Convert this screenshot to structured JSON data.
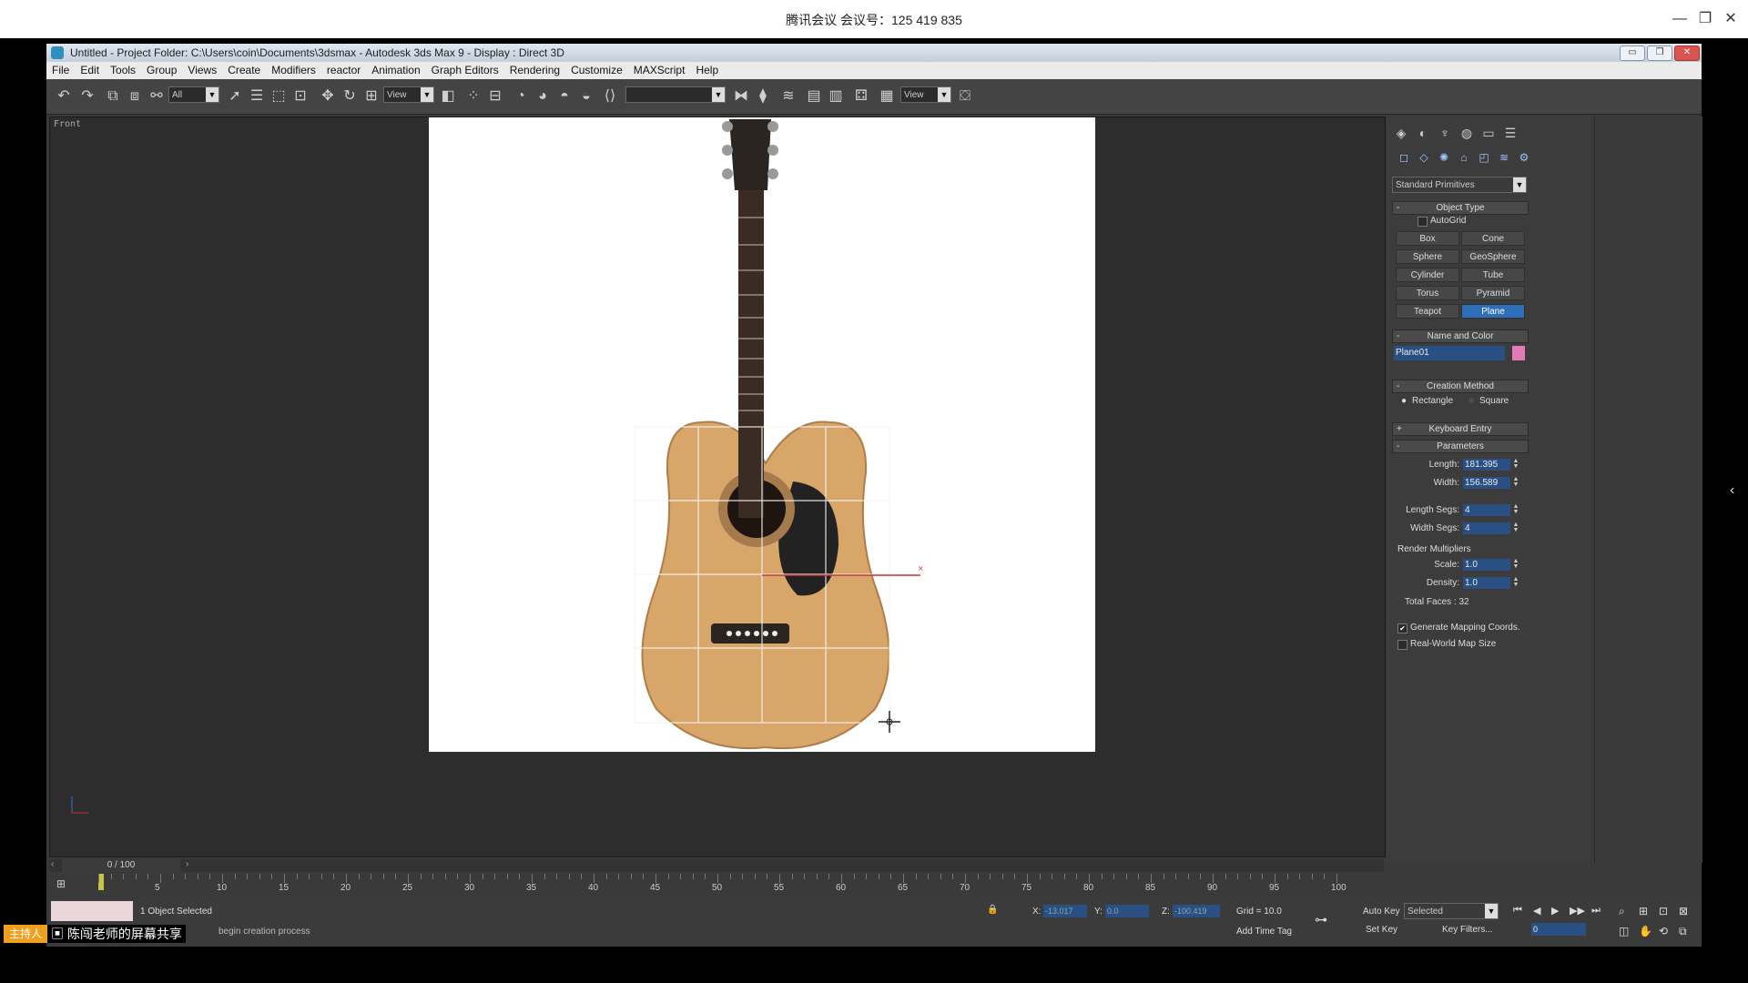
{
  "meeting": {
    "title": "腾讯会议 会议号：125 419 835",
    "host_badge": "主持人",
    "share_label": "陈闯老师的屏幕共享",
    "controls": [
      "—",
      "❐",
      "✕"
    ]
  },
  "window": {
    "title": "Untitled     - Project Folder: C:\\Users\\coin\\Documents\\3dsmax     - Autodesk 3ds Max 9     - Display : Direct 3D",
    "buttons": [
      "▭",
      "❐",
      "✕"
    ]
  },
  "menu": [
    "File",
    "Edit",
    "Tools",
    "Group",
    "Views",
    "Create",
    "Modifiers",
    "reactor",
    "Animation",
    "Graph Editors",
    "Rendering",
    "Customize",
    "MAXScript",
    "Help"
  ],
  "toolbar": {
    "selection_filter": "All",
    "ref_coord": "View",
    "named_selection": "",
    "view_dropdown": "View"
  },
  "viewport": {
    "label": "Front",
    "time_display": "0 / 100"
  },
  "command_panel": {
    "category": "Standard Primitives",
    "object_type": {
      "header": "Object Type",
      "autogrid": "AutoGrid",
      "buttons": [
        {
          "label": "Box",
          "active": false
        },
        {
          "label": "Cone",
          "active": false
        },
        {
          "label": "Sphere",
          "active": false
        },
        {
          "label": "GeoSphere",
          "active": false
        },
        {
          "label": "Cylinder",
          "active": false
        },
        {
          "label": "Tube",
          "active": false
        },
        {
          "label": "Torus",
          "active": false
        },
        {
          "label": "Pyramid",
          "active": false
        },
        {
          "label": "Teapot",
          "active": false
        },
        {
          "label": "Plane",
          "active": true
        }
      ]
    },
    "name_color": {
      "header": "Name and Color",
      "name": "Plane01",
      "color": "#e07ab8"
    },
    "creation_method": {
      "header": "Creation Method",
      "rectangle": "Rectangle",
      "square": "Square"
    },
    "keyboard_entry": "Keyboard Entry",
    "parameters": {
      "header": "Parameters",
      "length_label": "Length:",
      "length": "181.395",
      "width_label": "Width:",
      "width": "156.589",
      "length_segs_label": "Length Segs:",
      "length_segs": "4",
      "width_segs_label": "Width Segs:",
      "width_segs": "4",
      "render_mult": "Render Multipliers",
      "scale_label": "Scale:",
      "scale": "1.0",
      "density_label": "Density:",
      "density": "1.0",
      "total_faces": "Total Faces : 32",
      "gen_mapping": "Generate Mapping Coords.",
      "real_world": "Real-World Map Size"
    }
  },
  "timeline": {
    "ticks": [
      "5",
      "10",
      "15",
      "20",
      "25",
      "30",
      "35",
      "40",
      "45",
      "50",
      "55",
      "60",
      "65",
      "70",
      "75",
      "80",
      "85",
      "90",
      "95",
      "100"
    ]
  },
  "status": {
    "selected": "1 Object Selected",
    "prompt": "begin creation process",
    "x_label": "X:",
    "x": "-13.017",
    "y_label": "Y:",
    "y": "0.0",
    "z_label": "Z:",
    "z": "-100.419",
    "grid": "Grid = 10.0",
    "add_time_tag": "Add Time Tag",
    "auto_key": "Auto Key",
    "set_key": "Set Key",
    "key_mode": "Selected",
    "key_filters": "Key Filters...",
    "frame": "0"
  }
}
